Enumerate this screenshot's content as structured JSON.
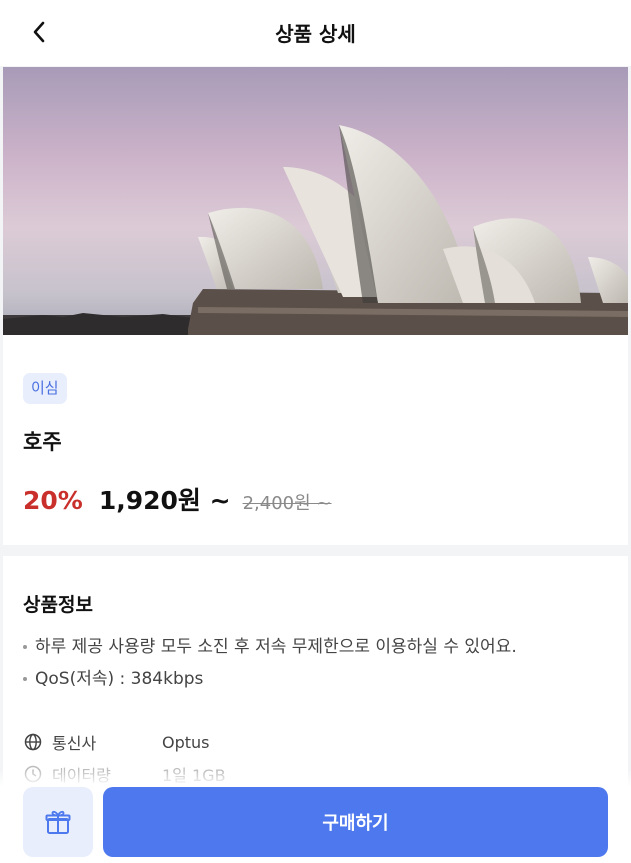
{
  "header": {
    "title": "상품 상세",
    "back_icon": "chevron-left-icon"
  },
  "hero": {
    "image": "sydney-opera-house-photo"
  },
  "product": {
    "tag": "이심",
    "name": "호주",
    "discount": "20%",
    "price": "1,920원 ~",
    "original_price": "2,400원 ~"
  },
  "detail": {
    "title": "상품정보",
    "bullets": [
      "하루 제공 사용량 모두 소진 후 저속 무제한으로 이용하실 수 있어요.",
      "QoS(저속) : 384kbps"
    ],
    "specs": [
      {
        "icon": "globe-icon",
        "label": "통신사",
        "value": "Optus"
      },
      {
        "icon": "clock-icon",
        "label": "데이터량",
        "value": "1일 1GB"
      }
    ]
  },
  "footer": {
    "gift_icon": "gift-icon",
    "buy_label": "구매하기"
  },
  "colors": {
    "accent": "#4d78ee",
    "tag_bg": "#e8eefc",
    "discount": "#c9302c"
  }
}
